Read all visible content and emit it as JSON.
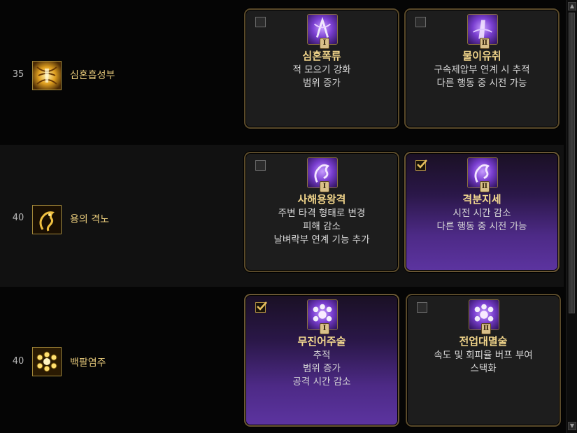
{
  "rows": [
    {
      "level": "35",
      "skill": "심혼흡성부",
      "skill_icon": "soul-absorb-icon",
      "options": [
        {
          "roman": "Ⅰ",
          "title": "심혼폭류",
          "desc": [
            "적 모으기 강화",
            "범위 증가"
          ],
          "checked": false
        },
        {
          "roman": "Ⅱ",
          "title": "물이유취",
          "desc": [
            "구속제압부 연계 시 추적",
            "다른 행동 중 시전 가능"
          ],
          "checked": false
        }
      ]
    },
    {
      "level": "40",
      "skill": "용의 격노",
      "skill_icon": "dragon-icon",
      "options": [
        {
          "roman": "Ⅰ",
          "title": "사해용왕격",
          "desc": [
            "주변 타격 형태로 변경",
            "피해 감소",
            "날벼락부 연계 기능 추가"
          ],
          "checked": false
        },
        {
          "roman": "Ⅱ",
          "title": "격분지세",
          "desc": [
            "시전 시간 감소",
            "다른 행동 중 시전 가능"
          ],
          "checked": true
        }
      ]
    },
    {
      "level": "40",
      "skill": "백팔염주",
      "skill_icon": "prayer-beads-icon",
      "options": [
        {
          "roman": "Ⅰ",
          "title": "무진어주술",
          "desc": [
            "추적",
            "범위 증가",
            "공격 시간 감소"
          ],
          "checked": true
        },
        {
          "roman": "Ⅱ",
          "title": "전업대멸술",
          "desc": [
            "속도 및 회피율 버프 부여",
            "스택화"
          ],
          "checked": false
        }
      ]
    }
  ],
  "colors": {
    "gold_text": "#e6c97a",
    "title_text": "#f0d48a",
    "active_purple": "#5c34a0",
    "card_border": "#5a4a2a"
  }
}
